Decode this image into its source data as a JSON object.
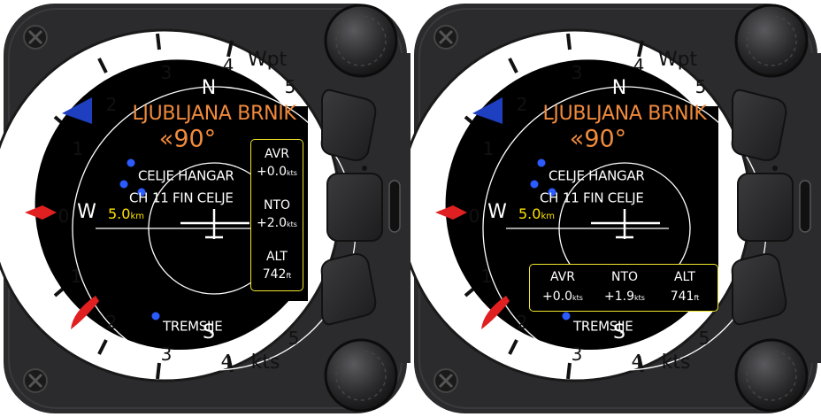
{
  "colors": {
    "bezel": "#2b2b2d",
    "screen": "#000000",
    "scale_ring": "#ffffff",
    "airfield_text": "#f08a3c",
    "infobox_border": "#f2e52a",
    "distance_text": "#ffe400",
    "turnpoint_dot": "#2b5cff",
    "wind_triangle": "#1e3fbf",
    "climb_pointer": "#e02020",
    "mc_pointer": "#e02020"
  },
  "icons": [
    "screw-icon",
    "knob-icon",
    "soft-button-icon",
    "glider-icon",
    "wind-triangle-icon",
    "climb-pointer-icon",
    "mc-diamond-icon",
    "turnpoint-dot-icon"
  ],
  "instruments": [
    {
      "id": "left",
      "scale": {
        "upper_numbers": [
          "1",
          "2",
          "3",
          "4",
          "5"
        ],
        "lower_numbers": [
          "1",
          "2",
          "3",
          "4",
          "5"
        ],
        "zero": "0",
        "upper_label": "Wpt",
        "lower_label": "kts"
      },
      "map": {
        "destination": "LJUBLJANA BRNIK",
        "bearing": "«90°",
        "compass_north": "N",
        "compass_west": "W",
        "compass_south": "S",
        "turnpoints": [
          "CELJE HANGAR",
          "CH",
          "11 FIN CELJE",
          "TREMSIJE"
        ],
        "distance_value": "5.0",
        "distance_unit": "km"
      },
      "infobox": {
        "layout": "vertical",
        "items": [
          {
            "title": "AVR",
            "value": "+0.0",
            "unit": "kts"
          },
          {
            "title": "NTO",
            "value": "+2.0",
            "unit": "kts"
          },
          {
            "title": "ALT",
            "value": "742",
            "unit": "ft"
          }
        ]
      }
    },
    {
      "id": "right",
      "scale": {
        "upper_numbers": [
          "1",
          "2",
          "3",
          "4",
          "5"
        ],
        "lower_numbers": [
          "1",
          "2",
          "3",
          "4",
          "5"
        ],
        "zero": "0",
        "upper_label": "Wpt",
        "lower_label": "kts"
      },
      "map": {
        "destination": "LJUBLJANA BRNIK",
        "bearing": "«90°",
        "compass_north": "N",
        "compass_west": "W",
        "compass_south": "S",
        "turnpoints": [
          "CELJE HANGAR",
          "CH",
          "11 FIN CELJE",
          "TREMSIJE"
        ],
        "distance_value": "5.0",
        "distance_unit": "km"
      },
      "infobox": {
        "layout": "horizontal",
        "items": [
          {
            "title": "AVR",
            "value": "+0.0",
            "unit": "kts"
          },
          {
            "title": "NTO",
            "value": "+1.9",
            "unit": "kts"
          },
          {
            "title": "ALT",
            "value": "741",
            "unit": "ft"
          }
        ]
      }
    }
  ]
}
